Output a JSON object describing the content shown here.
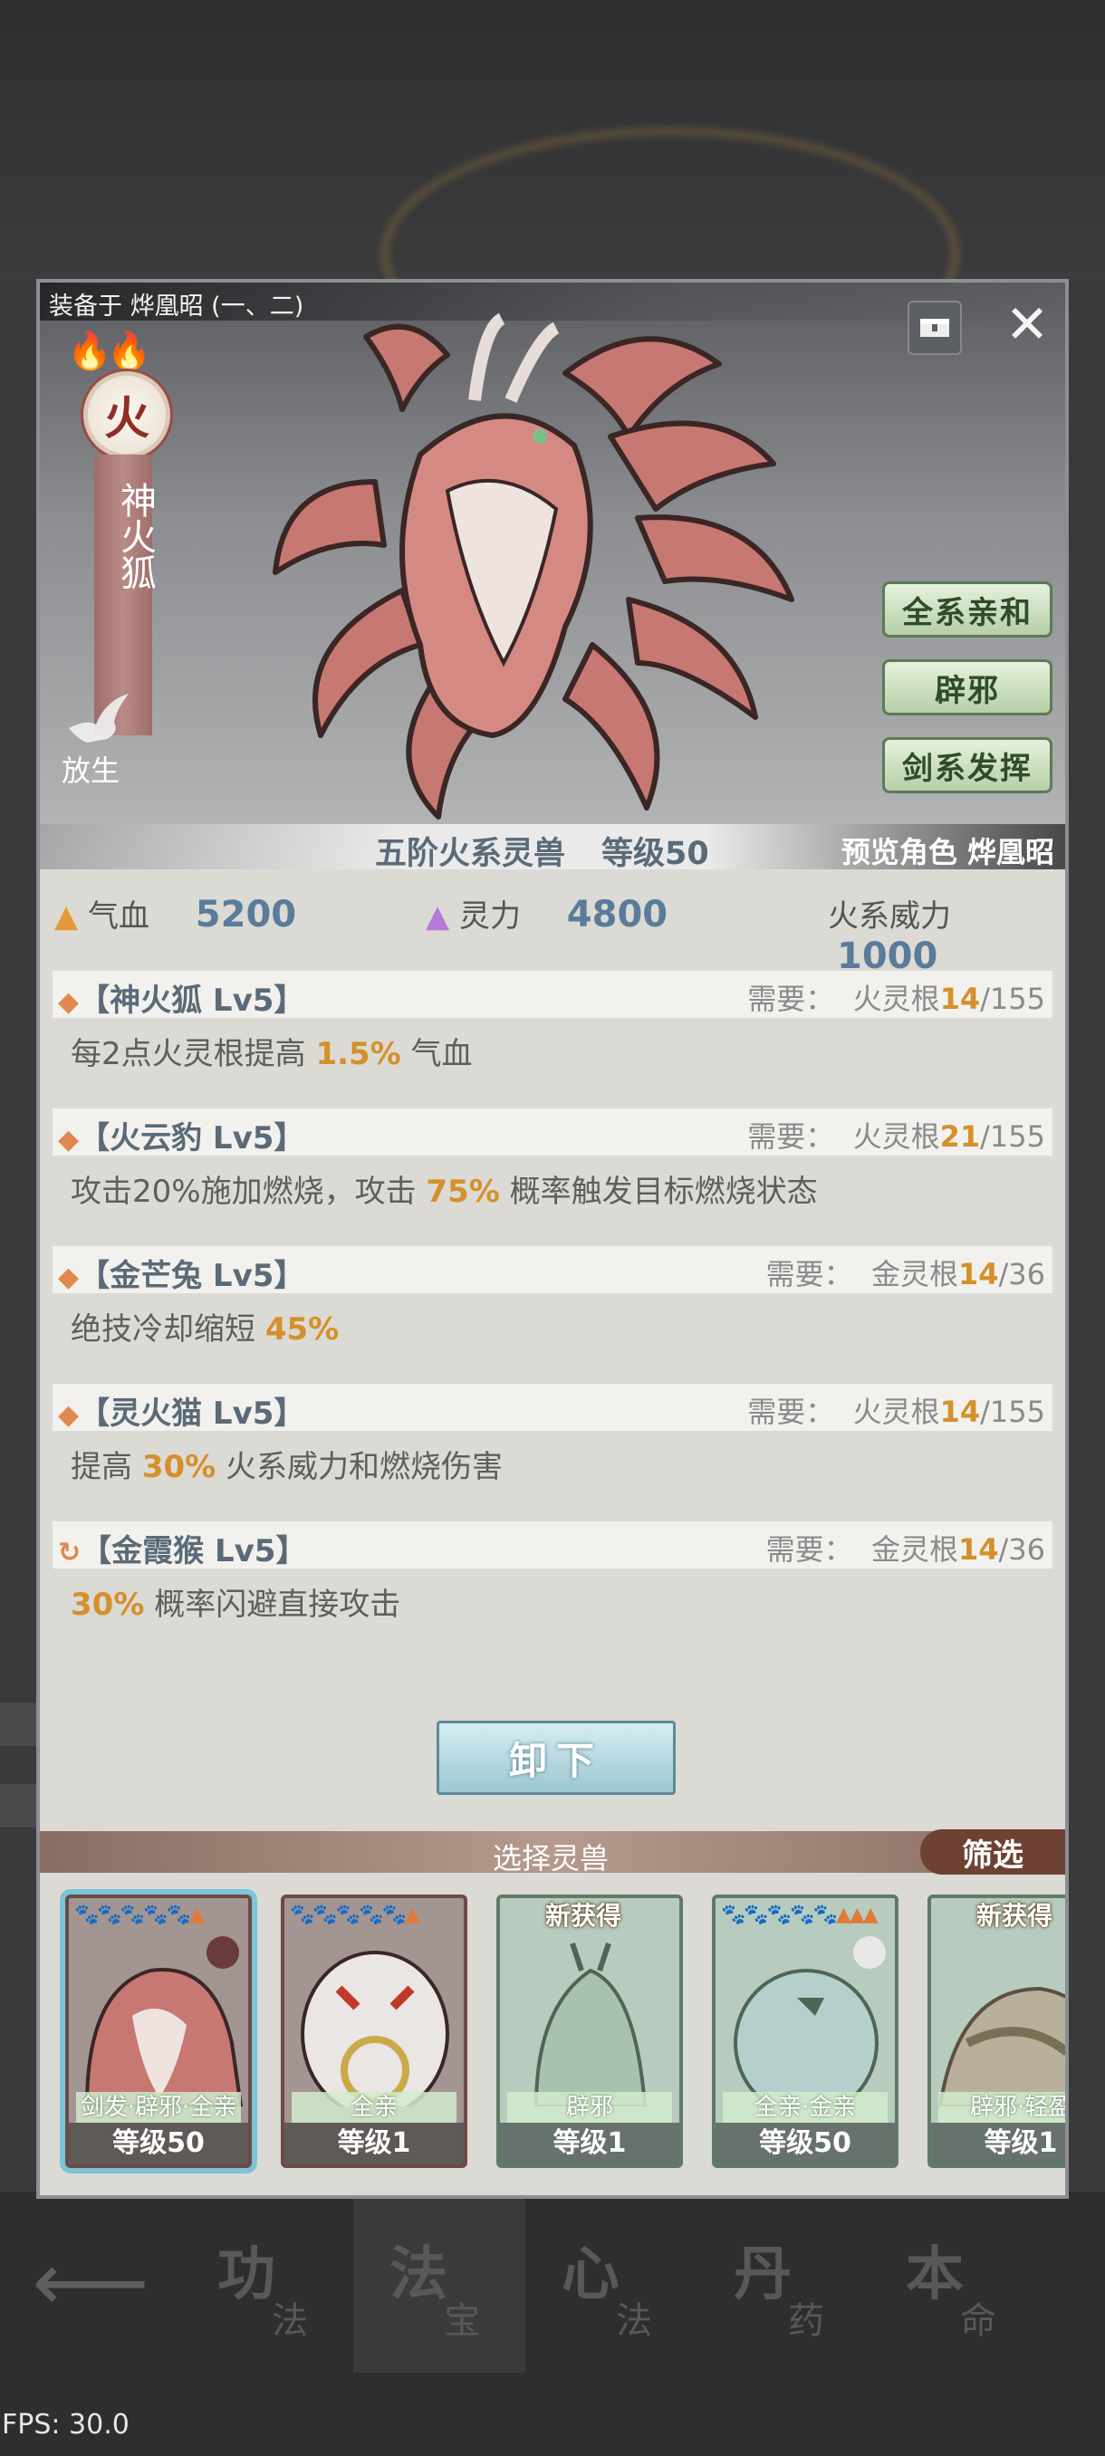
{
  "background_nav": {
    "back_icon": "arrow-left-icon",
    "items": [
      {
        "big": "功",
        "small": "法"
      },
      {
        "big": "法",
        "small": "宝"
      },
      {
        "big": "心",
        "small": "法"
      },
      {
        "big": "丹",
        "small": "药"
      },
      {
        "big": "本",
        "small": "命"
      }
    ]
  },
  "fps": "FPS: 30.0",
  "panel": {
    "equipped_label": "装备于 烨凰昭 (一、二)",
    "element": "火",
    "beast_name": "神火狐",
    "release_label": "放生",
    "traits": [
      "全系亲和",
      "辟邪",
      "剑系发挥"
    ],
    "rank": "五阶火系灵兽",
    "level": "等级50",
    "preview": "预览角色 烨凰昭",
    "stats": {
      "hp_label": "气血",
      "hp": "5200",
      "spirit_label": "灵力",
      "spirit": "4800",
      "fire_label": "火系威力",
      "fire": "1000"
    },
    "skills": [
      {
        "icon": "◆",
        "name": "【神火狐 Lv5】",
        "req_label": "需要：",
        "req_root": "火灵根",
        "req_cur": "14",
        "req_max": "/155",
        "desc_pre": "每2点火灵根提高 ",
        "desc_hl": "1.5%",
        "desc_post": " 气血"
      },
      {
        "icon": "◆",
        "name": "【火云豹 Lv5】",
        "req_label": "需要：",
        "req_root": "火灵根",
        "req_cur": "21",
        "req_max": "/155",
        "desc_pre": "攻击20%施加燃烧，攻击 ",
        "desc_hl": "75%",
        "desc_post": " 概率触发目标燃烧状态"
      },
      {
        "icon": "◆",
        "name": "【金芒兔 Lv5】",
        "req_label": "需要：",
        "req_root": "金灵根",
        "req_cur": "14",
        "req_max": "/36",
        "desc_pre": "绝技冷却缩短 ",
        "desc_hl": "45%",
        "desc_post": ""
      },
      {
        "icon": "◆",
        "name": "【灵火猫 Lv5】",
        "req_label": "需要：",
        "req_root": "火灵根",
        "req_cur": "14",
        "req_max": "/155",
        "desc_pre": "提高 ",
        "desc_hl": "30%",
        "desc_post": " 火系威力和燃烧伤害"
      },
      {
        "icon": "↻",
        "name": "【金霞猴 Lv5】",
        "req_label": "需要：",
        "req_root": "金灵根",
        "req_cur": "14",
        "req_max": "/36",
        "desc_pre": "",
        "desc_hl": "30%",
        "desc_post": " 概率闪避直接攻击"
      }
    ],
    "unequip_label": "卸下",
    "select_title": "选择灵兽",
    "filter_label": "筛选",
    "cards": [
      {
        "tags": "剑发·辟邪·全亲",
        "level": "等级50",
        "new": "",
        "colors": "red",
        "selected": true
      },
      {
        "tags": "全亲",
        "level": "等级1",
        "new": "",
        "colors": "red",
        "selected": false
      },
      {
        "tags": "辟邪",
        "level": "等级1",
        "new": "新获得",
        "colors": "green",
        "selected": false
      },
      {
        "tags": "全亲·金亲",
        "level": "等级50",
        "new": "",
        "colors": "green",
        "selected": false
      },
      {
        "tags": "辟邪·轻盈",
        "level": "等级1",
        "new": "新获得",
        "colors": "green",
        "selected": false
      }
    ]
  },
  "colors": {
    "accent_orange": "#d4902b",
    "trait_green": "#b6cfa8",
    "unequip_blue": "#9cc6d2"
  }
}
